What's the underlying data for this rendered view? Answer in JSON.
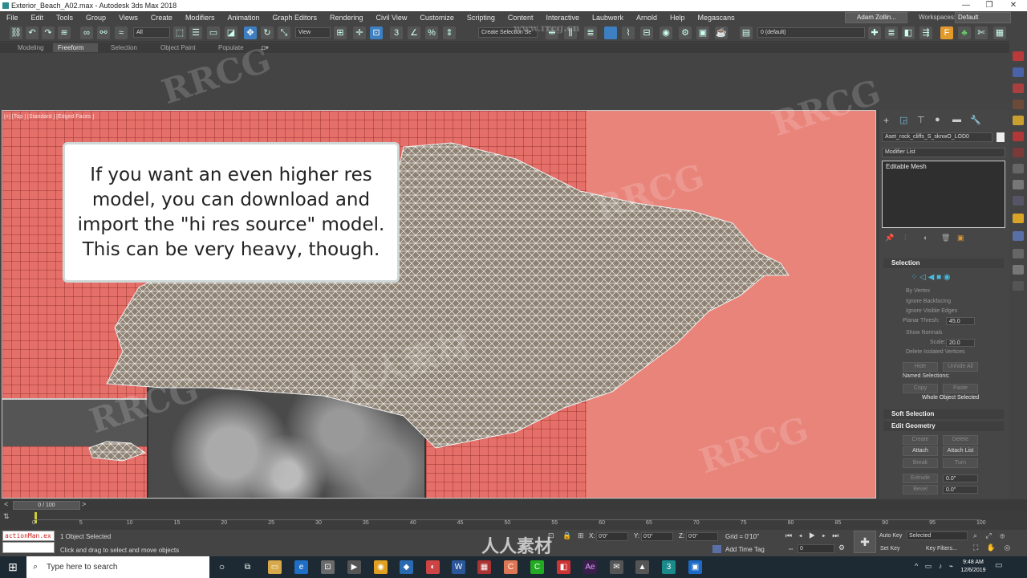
{
  "window": {
    "title": "Exterior_Beach_A02.max - Autodesk 3ds Max 2018",
    "minimize": "—",
    "maximize": "❐",
    "close": "✕"
  },
  "menu": {
    "items": [
      "File",
      "Edit",
      "Tools",
      "Group",
      "Views",
      "Create",
      "Modifiers",
      "Animation",
      "Graph Editors",
      "Rendering",
      "Civil View",
      "Customize",
      "Scripting",
      "Content",
      "Interactive",
      "Laubwerk",
      "Arnold",
      "Help",
      "Megascans"
    ],
    "user": "Adam Zollin...",
    "workspaces_label": "Workspaces:",
    "workspace_value": "Default"
  },
  "toolbar": {
    "filter_value": "All",
    "refcoord_value": "View",
    "selection_set": "Create Selection Se",
    "layer_value": "0 (default)"
  },
  "ribbon": {
    "tabs": [
      "Modeling",
      "Freeform",
      "Selection",
      "Object Paint",
      "Populate"
    ],
    "active_tab": "Freeform"
  },
  "viewport": {
    "label": "[+] [Top ] [Standard ] [Edged Faces ]",
    "callout": "If you want an even higher res model, you can download and import the \"hi res source\" model. This can be very heavy, though."
  },
  "command_panel": {
    "object_name": "Aset_rock_cliffs_S_sknwO_LOD0",
    "modifier_list": "Modifier List",
    "stack_item": "Editable Mesh",
    "selection_title": "Selection",
    "by_vertex": "By Vertex",
    "ignore_backfacing": "Ignore Backfacing",
    "ignore_visible_edges": "Ignore Visible Edges",
    "planar_thresh_label": "Planar Thresh:",
    "planar_thresh_value": "45.0",
    "show_normals": "Show Normals",
    "scale_label": "Scale:",
    "scale_value": "20.0",
    "delete_isolated": "Delete Isolated Vertices",
    "hide": "Hide",
    "unhide_all": "Unhide All",
    "named_selections": "Named Selections:",
    "copy": "Copy",
    "paste": "Paste",
    "whole_object_selected": "Whole Object Selected",
    "soft_selection_title": "Soft Selection",
    "edit_geometry_title": "Edit Geometry",
    "create": "Create",
    "delete": "Delete",
    "attach": "Attach",
    "attach_list": "Attach List",
    "break": "Break",
    "turn": "Turn",
    "extrude": "Extrude",
    "extrude_value": "0.0\"",
    "bevel": "Bevel",
    "bevel_value": "0.0\""
  },
  "timeline": {
    "frame": "0 / 100",
    "ticks": [
      "0",
      "5",
      "10",
      "15",
      "20",
      "25",
      "30",
      "35",
      "40",
      "45",
      "50",
      "55",
      "60",
      "65",
      "70",
      "75",
      "80",
      "85",
      "90",
      "95",
      "100"
    ]
  },
  "status": {
    "maxscript": "actionMan.ex",
    "objects_selected": "1 Object Selected",
    "prompt": "Click and drag to select and move objects",
    "x_label": "X:",
    "x_value": "0'0\"",
    "y_label": "Y:",
    "y_value": "0'0\"",
    "z_label": "Z:",
    "z_value": "0'0\"",
    "grid": "Grid = 0'10\"",
    "add_time_tag": "Add Time Tag",
    "current_frame": "0",
    "auto_key": "Auto Key",
    "set_key": "Set Key",
    "key_mode": "Selected",
    "key_filters": "Key Filters..."
  },
  "taskbar": {
    "search_placeholder": "Type here to search",
    "time": "9:48 AM",
    "date": "12/6/2019"
  },
  "watermarks": {
    "text": "RRCG",
    "cn_text": "人人素材",
    "url": "www.rrcg.cn"
  }
}
